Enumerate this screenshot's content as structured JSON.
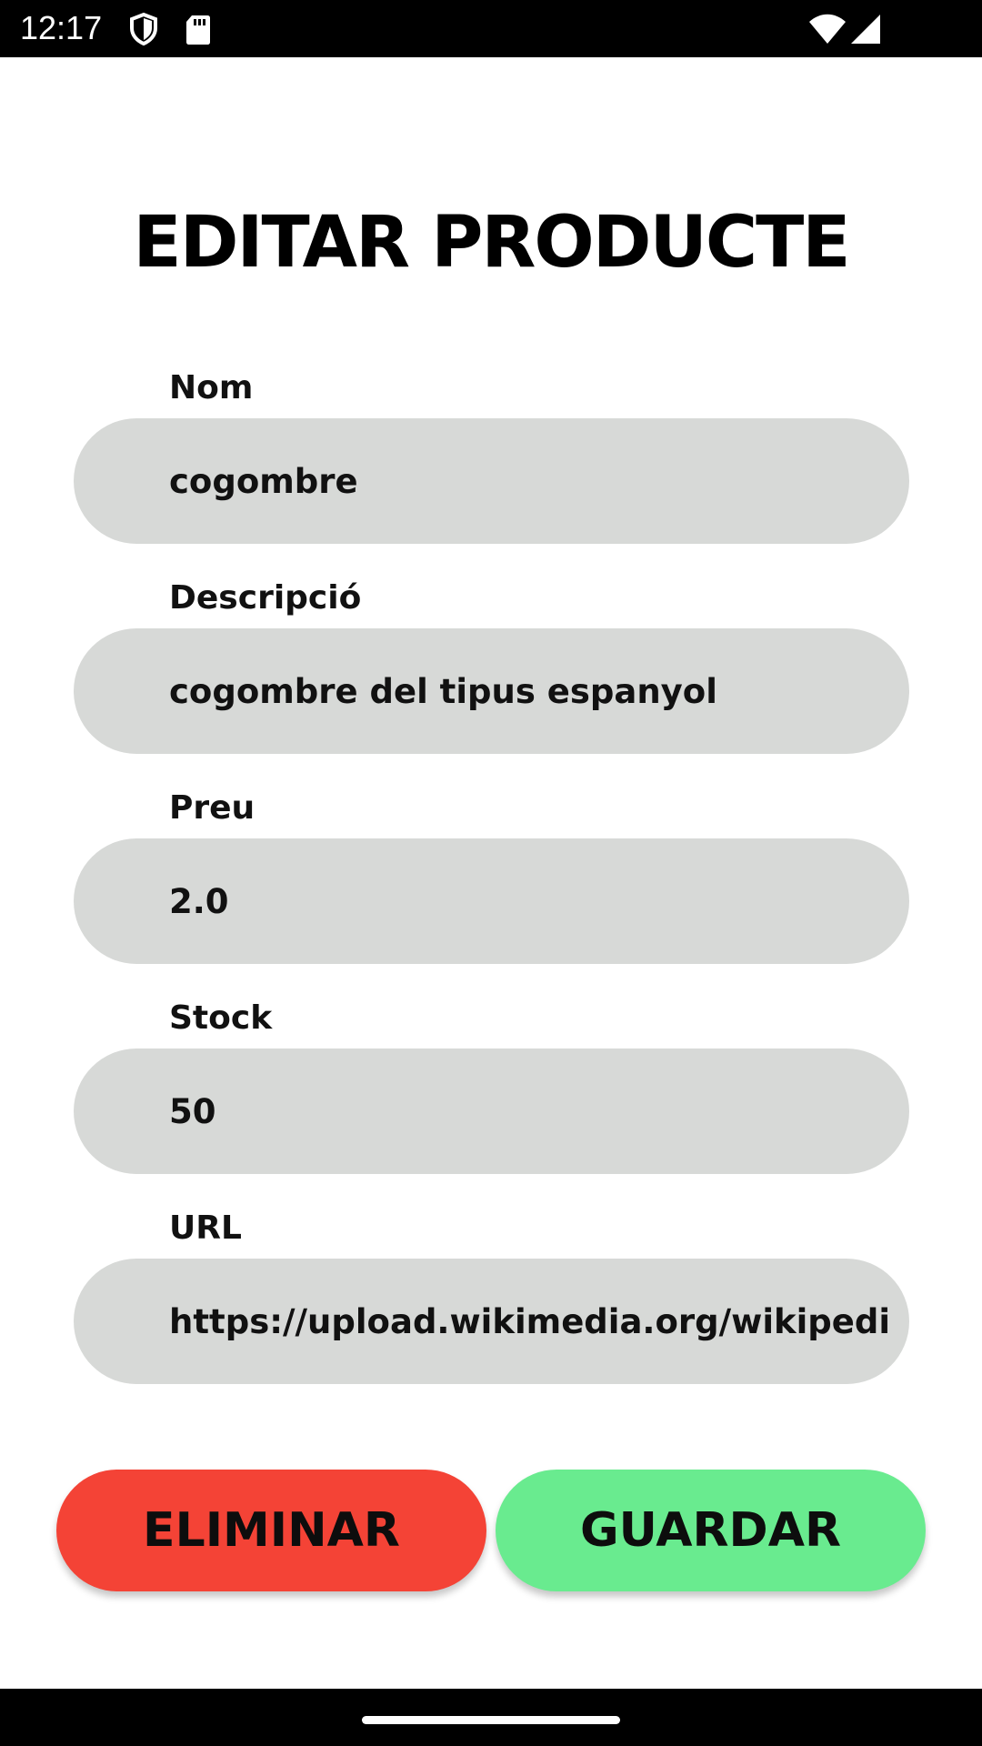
{
  "status_bar": {
    "time": "12:17",
    "icons": [
      "shield-icon",
      "sd-card-icon",
      "wifi-icon",
      "signal-icon"
    ]
  },
  "page": {
    "title": "EDITAR PRODUCTE"
  },
  "form": {
    "fields": [
      {
        "label": "Nom",
        "value": "cogombre"
      },
      {
        "label": "Descripció",
        "value": "cogombre del tipus espanyol"
      },
      {
        "label": "Preu",
        "value": "2.0"
      },
      {
        "label": "Stock",
        "value": "50"
      },
      {
        "label": "URL",
        "value": "https://upload.wikimedia.org/wikipedia"
      }
    ]
  },
  "actions": {
    "delete_label": "ELIMINAR",
    "save_label": "GUARDAR"
  },
  "colors": {
    "delete_button": "#f44336",
    "save_button": "#69eb8f",
    "field_background": "#d7d9d7"
  }
}
